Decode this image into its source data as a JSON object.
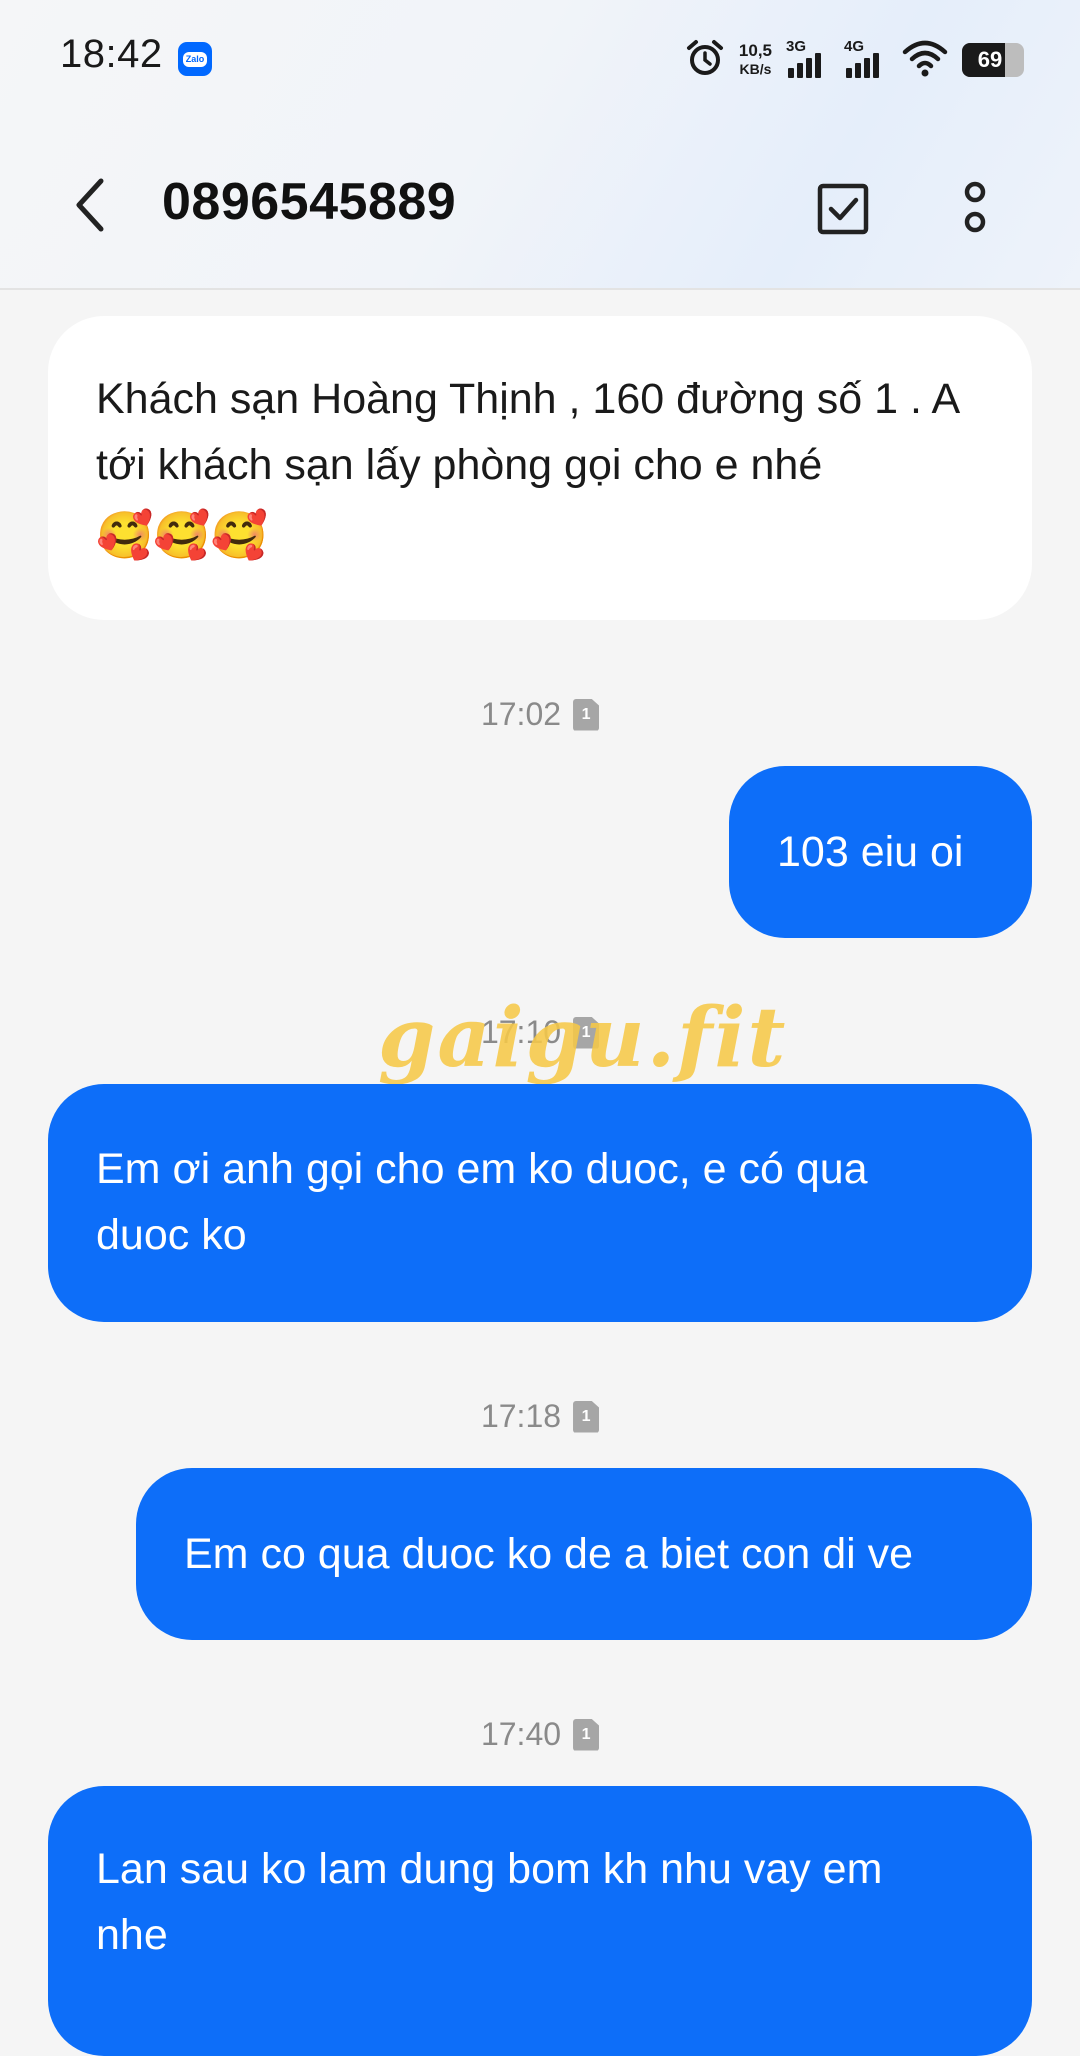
{
  "status_bar": {
    "time": "18:42",
    "notification_app": "Zalo",
    "net_speed": "10,5",
    "net_speed_unit": "KB/s",
    "sim1_tag": "3G",
    "sim2_tag": "4G",
    "battery_level": "69",
    "icons": [
      "alarm-icon",
      "signal-icon",
      "wifi-icon",
      "battery-icon"
    ]
  },
  "header": {
    "title": "0896545889",
    "back_icon": "chevron-left-icon",
    "select_icon": "checkbox-icon",
    "more_icon": "more-vertical-icon"
  },
  "messages": [
    {
      "direction": "incoming",
      "text": "Khách sạn Hoàng Thịnh , 160 đường số 1 . A tới khách sạn lấy phòng gọi cho e nhé",
      "emoji": "🥰🥰🥰"
    },
    {
      "direction": "outgoing",
      "time": "17:02",
      "sim": "1",
      "text": "103 eiu oi"
    },
    {
      "direction": "outgoing",
      "time": "17:10",
      "sim": "1",
      "text": "Em ơi anh gọi cho em ko duoc, e có qua duoc ko"
    },
    {
      "direction": "outgoing",
      "time": "17:18",
      "sim": "1",
      "text": "Em co qua duoc ko de a biet con di ve"
    },
    {
      "direction": "outgoing",
      "time": "17:40",
      "sim": "1",
      "text": "Lan sau ko lam dung bom kh nhu vay em nhe"
    }
  ],
  "watermark": "gaigu.fit",
  "colors": {
    "outgoing_bubble": "#0d6ef9",
    "incoming_bubble": "#ffffff",
    "background": "#f5f5f5",
    "watermark": "#f6c848"
  }
}
